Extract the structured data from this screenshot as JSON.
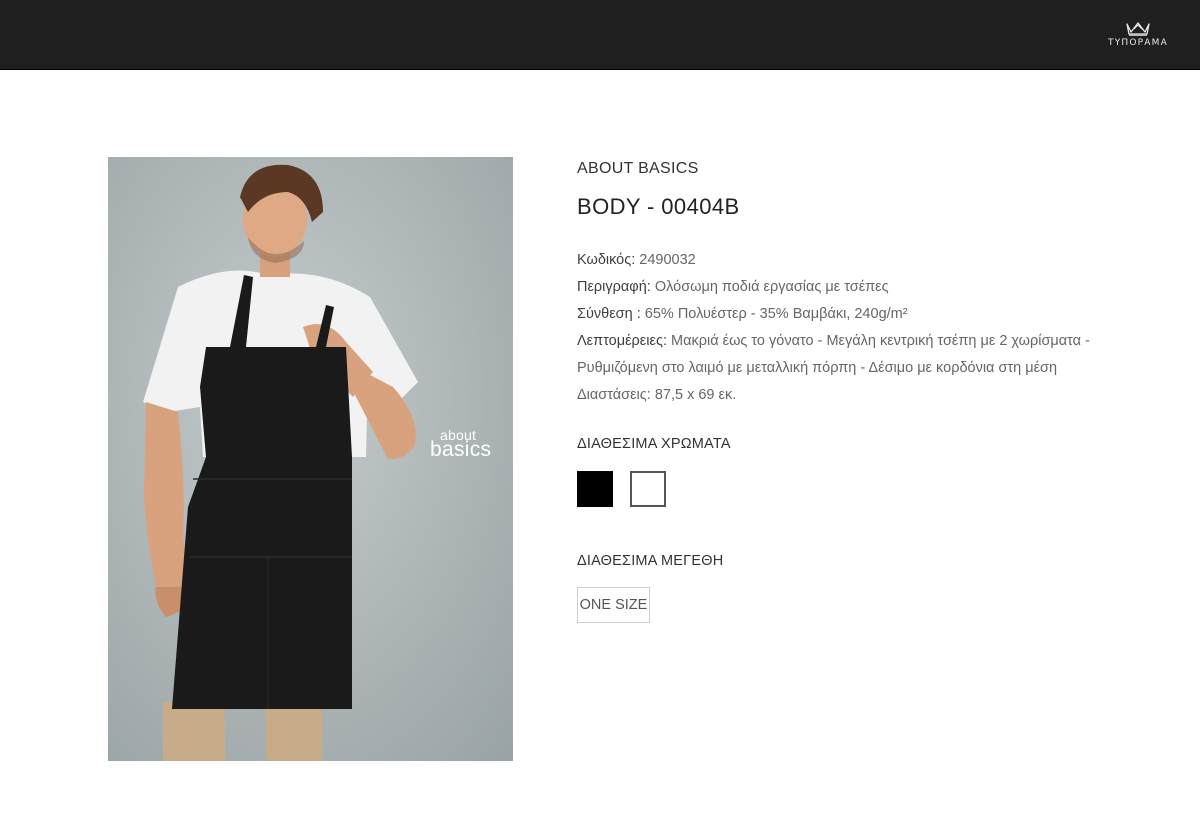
{
  "header": {
    "brand_name": "ΤΥΠΟΡΑΜΑ",
    "logo_icon": "crown-icon",
    "background": "#1f1f1f"
  },
  "photo": {
    "logo_line1": "about",
    "logo_line2": "basics",
    "background": "#b5bdbe"
  },
  "product": {
    "brand": "ABOUT BASICS",
    "title": "BODY - 00404B",
    "code_label": "Κωδικός:",
    "code_value": " 2490032",
    "description_label": "Περιγραφή:",
    "description_value": " Ολόσωμη ποδιά εργασίας με τσέπες",
    "composition_label": "Σύνθεση :",
    "composition_value": " 65% Πολυέστερ - 35% Βαμβάκι, 240g/m²",
    "details_label": "Λεπτομέρειες:",
    "details_value": " Μακριά έως το γόνατο - Μεγάλη κεντρική τσέπη με 2 χωρίσματα -",
    "details_line2": "Ρυθμιζόμενη στο λαιμό με μεταλλική πόρπη - Δέσιμο με κορδόνια στη μέση",
    "details_line3": "Διαστάσεις: 87,5 x 69 εκ."
  },
  "colors": {
    "heading": "ΔΙΑΘΕΣΙΜΑ ΧΡΩΜΑΤΑ",
    "swatches": [
      "#000000",
      "#ffffff"
    ]
  },
  "sizes": {
    "heading": "ΔΙΑΘΕΣΙΜΑ ΜΕΓΕΘΗ",
    "options": [
      "ONE SIZE"
    ]
  }
}
